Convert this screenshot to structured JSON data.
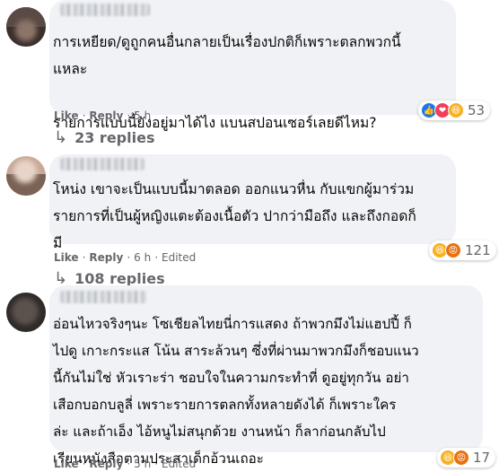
{
  "comments": [
    {
      "text": "การเหยียด/ดูถูกคนอื่นกลายเป็นเรื่องปกติก็เพราะตลกพวกนี้\nแหละ\n\nรายการแบบนี้ยังอยู่มาได้ไง แบนสปอนเซอร์เลยดีไหม?",
      "like": "Like",
      "reply": "Reply",
      "time": "5 h",
      "reactions": [
        "like-icon",
        "love-icon",
        "haha-icon"
      ],
      "reaction_count": "53",
      "replies": "23 replies"
    },
    {
      "text": "โหน่ง เขาจะเป็นแบบนี้มาตลอด ออกแนวหื่น กับแขกผู้มาร่วม\nรายการที่เป็นผู้หญิงแตะต้องเนื้อตัว ปากว่ามือถึง และถึงกอดก็\nมี",
      "like": "Like",
      "reply": "Reply",
      "time": "6 h",
      "edited": "Edited",
      "reactions": [
        "haha-icon",
        "angry-icon"
      ],
      "reaction_count": "121",
      "replies": "108 replies"
    },
    {
      "text": "อ่อนไหวจริงๆนะ โซเชียลไทยนี่การแสดง ถ้าพวกมึงไม่แฮปปี้ ก็\nไปดู เกาะกระแส โน้น สาระล้วนๆ ซึ่งที่ผ่านมาพวกมึงก็ชอบแนว\nนี้กันไม่ใช่ หัวเราะร่า ชอบใจในความกระทำที่ ดูอยู่ทุกวัน อย่า\nเสือกบอกบลูลี่ เพราะรายการตลกทั้งหลายดังได้ ก็เพราะใคร\nล่ะ และถ้าเอ็ง ไอ้หนูไม่สนุกด้วย งานหน้า ก็ลาก่อนกลับไป\nเรียนหนังสือตามประสาเด็กอ้วนเถอะ",
      "like": "Like",
      "reply": "Reply",
      "time": "5 h",
      "edited": "Edited",
      "reactions": [
        "haha-icon",
        "angry-icon"
      ],
      "reaction_count": "17"
    }
  ],
  "separator": "·",
  "reply_arrow": "↳"
}
